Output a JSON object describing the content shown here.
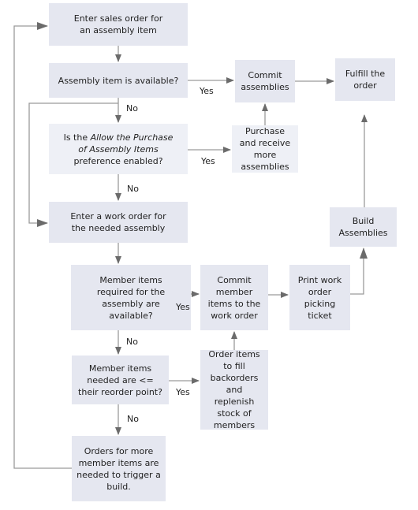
{
  "diagram": {
    "type": "flowchart",
    "colors": {
      "box_fill": "#e5e7f0",
      "box_fill_light": "#eef0f6",
      "connector": "#9a9a9a",
      "arrowhead": "#6b6b6b",
      "text": "#222222"
    },
    "nodes": {
      "enter_sales_order": "Enter sales order for an assembly item",
      "assembly_available": "Assembly item is available?",
      "allow_purchase_pref": {
        "prefix": "Is the ",
        "italic": "Allow the Purchase of Assembly Items",
        "suffix": " preference enabled?"
      },
      "enter_work_order": "Enter a work order for the needed assembly",
      "member_items_available": "Member items required for the assembly are available?",
      "member_items_reorder": "Member items needed are <= their reorder point?",
      "orders_more_members": "Orders for more member items are needed to trigger a build.",
      "commit_assemblies": "Commit assemblies",
      "fulfill_order": "Fulfill the order",
      "purchase_receive": "Purchase and receive more assemblies",
      "build_assemblies": "Build Assemblies",
      "commit_member_items": "Commit member items to the work order",
      "print_picking_ticket": "Print work order picking ticket",
      "order_items_backorders": "Order items to fill backorders and replenish stock of members"
    },
    "edge_labels": {
      "assembly_available_yes": "Yes",
      "assembly_available_no": "No",
      "allow_purchase_yes": "Yes",
      "allow_purchase_no": "No",
      "member_available_yes": "Yes",
      "member_available_no": "No",
      "reorder_yes": "Yes",
      "reorder_no": "No"
    },
    "edges": [
      {
        "from": "enter_sales_order",
        "to": "assembly_available"
      },
      {
        "from": "assembly_available",
        "to": "commit_assemblies",
        "label": "Yes"
      },
      {
        "from": "assembly_available",
        "to": "allow_purchase_pref",
        "label": "No"
      },
      {
        "from": "assembly_available",
        "to": "enter_work_order",
        "label": "No"
      },
      {
        "from": "allow_purchase_pref",
        "to": "purchase_receive",
        "label": "Yes"
      },
      {
        "from": "allow_purchase_pref",
        "to": "enter_work_order",
        "label": "No"
      },
      {
        "from": "purchase_receive",
        "to": "commit_assemblies"
      },
      {
        "from": "commit_assemblies",
        "to": "fulfill_order"
      },
      {
        "from": "enter_work_order",
        "to": "member_items_available"
      },
      {
        "from": "member_items_available",
        "to": "commit_member_items",
        "label": "Yes"
      },
      {
        "from": "member_items_available",
        "to": "member_items_reorder",
        "label": "No"
      },
      {
        "from": "member_items_reorder",
        "to": "order_items_backorders",
        "label": "Yes"
      },
      {
        "from": "member_items_reorder",
        "to": "orders_more_members",
        "label": "No"
      },
      {
        "from": "order_items_backorders",
        "to": "commit_member_items"
      },
      {
        "from": "commit_member_items",
        "to": "print_picking_ticket"
      },
      {
        "from": "print_picking_ticket",
        "to": "build_assemblies"
      },
      {
        "from": "build_assemblies",
        "to": "fulfill_order"
      },
      {
        "from": "orders_more_members",
        "to": "enter_sales_order"
      }
    ]
  }
}
